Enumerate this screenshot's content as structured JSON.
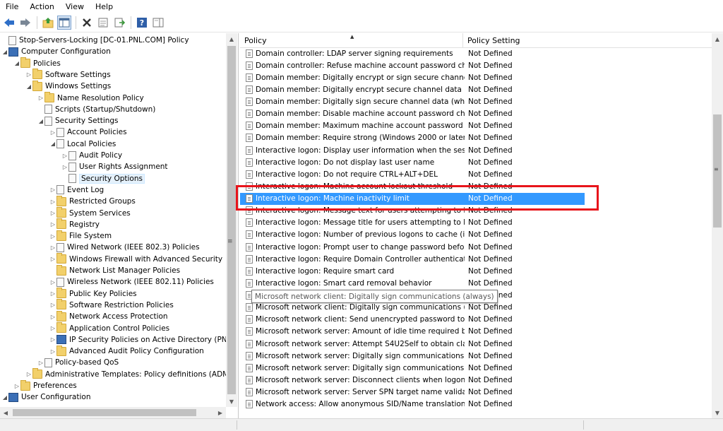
{
  "menu": [
    "File",
    "Action",
    "View",
    "Help"
  ],
  "toolbar_icons": [
    "back-arrow-icon",
    "forward-arrow-icon",
    "up-folder-icon",
    "show-hide-tree-icon",
    "delete-icon",
    "properties-icon",
    "export-list-icon",
    "help-icon",
    "show-hide-action-pane-icon"
  ],
  "tree": [
    {
      "label": "Stop-Servers-Locking [DC-01.PNL.COM] Policy",
      "level": 0,
      "arrow": "",
      "icon": "doc"
    },
    {
      "label": "Computer Configuration",
      "level": 0,
      "arrow": "down",
      "icon": "comp"
    },
    {
      "label": "Policies",
      "level": 1,
      "arrow": "down",
      "icon": "folder"
    },
    {
      "label": "Software Settings",
      "level": 2,
      "arrow": "right",
      "icon": "folder"
    },
    {
      "label": "Windows Settings",
      "level": 2,
      "arrow": "down",
      "icon": "folder"
    },
    {
      "label": "Name Resolution Policy",
      "level": 3,
      "arrow": "right",
      "icon": "folder"
    },
    {
      "label": "Scripts (Startup/Shutdown)",
      "level": 3,
      "arrow": "",
      "icon": "doc"
    },
    {
      "label": "Security Settings",
      "level": 3,
      "arrow": "down",
      "icon": "doc"
    },
    {
      "label": "Account Policies",
      "level": 4,
      "arrow": "right",
      "icon": "doc"
    },
    {
      "label": "Local Policies",
      "level": 4,
      "arrow": "down",
      "icon": "doc"
    },
    {
      "label": "Audit Policy",
      "level": 5,
      "arrow": "right",
      "icon": "doc"
    },
    {
      "label": "User Rights Assignment",
      "level": 5,
      "arrow": "right",
      "icon": "doc"
    },
    {
      "label": "Security Options",
      "level": 5,
      "arrow": "",
      "icon": "doc",
      "selected": true
    },
    {
      "label": "Event Log",
      "level": 4,
      "arrow": "right",
      "icon": "doc"
    },
    {
      "label": "Restricted Groups",
      "level": 4,
      "arrow": "right",
      "icon": "folder"
    },
    {
      "label": "System Services",
      "level": 4,
      "arrow": "right",
      "icon": "folder"
    },
    {
      "label": "Registry",
      "level": 4,
      "arrow": "right",
      "icon": "folder"
    },
    {
      "label": "File System",
      "level": 4,
      "arrow": "right",
      "icon": "folder"
    },
    {
      "label": "Wired Network (IEEE 802.3) Policies",
      "level": 4,
      "arrow": "right",
      "icon": "doc"
    },
    {
      "label": "Windows Firewall with Advanced Security",
      "level": 4,
      "arrow": "right",
      "icon": "folder"
    },
    {
      "label": "Network List Manager Policies",
      "level": 4,
      "arrow": "",
      "icon": "folder"
    },
    {
      "label": "Wireless Network (IEEE 802.11) Policies",
      "level": 4,
      "arrow": "right",
      "icon": "doc"
    },
    {
      "label": "Public Key Policies",
      "level": 4,
      "arrow": "right",
      "icon": "folder"
    },
    {
      "label": "Software Restriction Policies",
      "level": 4,
      "arrow": "right",
      "icon": "folder"
    },
    {
      "label": "Network Access Protection",
      "level": 4,
      "arrow": "right",
      "icon": "folder"
    },
    {
      "label": "Application Control Policies",
      "level": 4,
      "arrow": "right",
      "icon": "folder"
    },
    {
      "label": "IP Security Policies on Active Directory (PNL",
      "level": 4,
      "arrow": "right",
      "icon": "comp"
    },
    {
      "label": "Advanced Audit Policy Configuration",
      "level": 4,
      "arrow": "right",
      "icon": "folder"
    },
    {
      "label": "Policy-based QoS",
      "level": 3,
      "arrow": "right",
      "icon": "doc"
    },
    {
      "label": "Administrative Templates: Policy definitions (ADM)",
      "level": 2,
      "arrow": "right",
      "icon": "folder"
    },
    {
      "label": "Preferences",
      "level": 1,
      "arrow": "right",
      "icon": "folder"
    },
    {
      "label": "User Configuration",
      "level": 0,
      "arrow": "down",
      "icon": "comp"
    }
  ],
  "columns": {
    "policy": "Policy",
    "setting": "Policy Setting"
  },
  "policies": [
    {
      "name": "Domain controller: LDAP server signing requirements",
      "value": "Not Defined"
    },
    {
      "name": "Domain controller: Refuse machine account password chan...",
      "value": "Not Defined"
    },
    {
      "name": "Domain member: Digitally encrypt or sign secure channel d...",
      "value": "Not Defined"
    },
    {
      "name": "Domain member: Digitally encrypt secure channel data (wh...",
      "value": "Not Defined"
    },
    {
      "name": "Domain member: Digitally sign secure channel data (when ...",
      "value": "Not Defined"
    },
    {
      "name": "Domain member: Disable machine account password chan...",
      "value": "Not Defined"
    },
    {
      "name": "Domain member: Maximum machine account password age",
      "value": "Not Defined"
    },
    {
      "name": "Domain member: Require strong (Windows 2000 or later) se...",
      "value": "Not Defined"
    },
    {
      "name": "Interactive logon: Display user information when the session...",
      "value": "Not Defined"
    },
    {
      "name": "Interactive logon: Do not display last user name",
      "value": "Not Defined"
    },
    {
      "name": "Interactive logon: Do not require CTRL+ALT+DEL",
      "value": "Not Defined"
    },
    {
      "name": "Interactive logon: Machine account lockout threshold",
      "value": "Not Defined"
    },
    {
      "name": "Interactive logon: Machine inactivity limit",
      "value": "Not Defined",
      "selected": true
    },
    {
      "name": "Interactive logon: Message text for users attempting to log on",
      "value": "Not Defined"
    },
    {
      "name": "Interactive logon: Message title for users attempting to log on",
      "value": "Not Defined"
    },
    {
      "name": "Interactive logon: Number of previous logons to cache (in c...",
      "value": "Not Defined"
    },
    {
      "name": "Interactive logon: Prompt user to change password before e...",
      "value": "Not Defined"
    },
    {
      "name": "Interactive logon: Require Domain Controller authentication...",
      "value": "Not Defined"
    },
    {
      "name": "Interactive logon: Require smart card",
      "value": "Not Defined"
    },
    {
      "name": "Interactive logon: Smart card removal behavior",
      "value": "Not Defined"
    },
    {
      "name": "Microsoft network client: Digitally sign communications (always)",
      "value": "Not Defined"
    },
    {
      "name": "Microsoft network client: Digitally sign communications (if ...",
      "value": "Not Defined"
    },
    {
      "name": "Microsoft network client: Send unencrypted password to thi...",
      "value": "Not Defined"
    },
    {
      "name": "Microsoft network server: Amount of idle time required bef...",
      "value": "Not Defined"
    },
    {
      "name": "Microsoft network server: Attempt S4U2Self to obtain claim ...",
      "value": "Not Defined"
    },
    {
      "name": "Microsoft network server: Digitally sign communications (al...",
      "value": "Not Defined"
    },
    {
      "name": "Microsoft network server: Digitally sign communications (if ...",
      "value": "Not Defined"
    },
    {
      "name": "Microsoft network server: Disconnect clients when logon ho...",
      "value": "Not Defined"
    },
    {
      "name": "Microsoft network server: Server SPN target name validation...",
      "value": "Not Defined"
    },
    {
      "name": "Network access: Allow anonymous SID/Name translation",
      "value": "Not Defined"
    }
  ],
  "tooltip": "Microsoft network client: Digitally sign communications (always)"
}
